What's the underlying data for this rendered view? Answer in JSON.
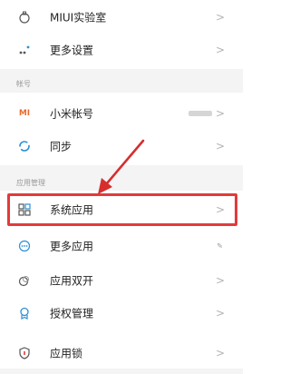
{
  "top_items": [
    {
      "label": "MIUI实验室",
      "icon": "flask-icon"
    },
    {
      "label": "更多设置",
      "icon": "dots-settings-icon"
    }
  ],
  "sections": {
    "account_header": "帐号",
    "apps_header": "应用管理"
  },
  "account_items": [
    {
      "label": "小米帐号",
      "icon": "mi-logo-icon",
      "badge_text": "MI"
    },
    {
      "label": "同步",
      "icon": "sync-icon"
    }
  ],
  "app_items": [
    {
      "label": "系统应用",
      "icon": "grid-apps-icon"
    },
    {
      "label": "更多应用",
      "icon": "more-apps-icon"
    },
    {
      "label": "应用双开",
      "icon": "dual-apps-icon"
    },
    {
      "label": "授权管理",
      "icon": "authorization-icon"
    },
    {
      "label": "应用锁",
      "icon": "app-lock-icon"
    }
  ],
  "chevron": ">",
  "colors": {
    "highlight": "#e23b3b",
    "accent_orange": "#e86b2c",
    "icon_blue": "#2b8fd6",
    "section_bg": "#f4f4f4"
  }
}
